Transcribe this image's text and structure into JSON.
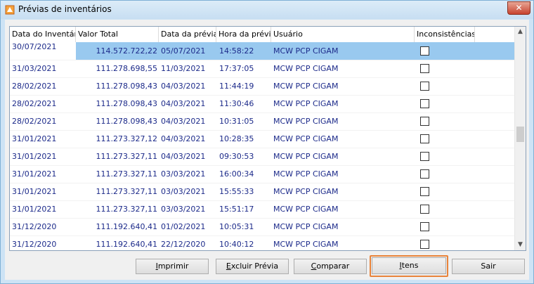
{
  "window": {
    "title": "Prévias de inventários",
    "close_label": "✕"
  },
  "columns": [
    "Data do Inventário",
    "Valor Total",
    "Data da prévia",
    "Hora da prévia",
    "Usuário",
    "Inconsistências"
  ],
  "rows": [
    {
      "date": "30/07/2021",
      "total": "114.572.722,22",
      "preview_date": "05/07/2021",
      "preview_time": "14:58:22",
      "user": "MCW  PCP CIGAM",
      "inconsistent": false
    },
    {
      "date": "31/03/2021",
      "total": "111.278.698,55",
      "preview_date": "11/03/2021",
      "preview_time": "17:37:05",
      "user": "MCW  PCP CIGAM",
      "inconsistent": false
    },
    {
      "date": "28/02/2021",
      "total": "111.278.098,43",
      "preview_date": "04/03/2021",
      "preview_time": "11:44:19",
      "user": "MCW  PCP CIGAM",
      "inconsistent": false
    },
    {
      "date": "28/02/2021",
      "total": "111.278.098,43",
      "preview_date": "04/03/2021",
      "preview_time": "11:30:46",
      "user": "MCW  PCP CIGAM",
      "inconsistent": false
    },
    {
      "date": "28/02/2021",
      "total": "111.278.098,43",
      "preview_date": "04/03/2021",
      "preview_time": "10:31:05",
      "user": "MCW  PCP CIGAM",
      "inconsistent": false
    },
    {
      "date": "31/01/2021",
      "total": "111.273.327,12",
      "preview_date": "04/03/2021",
      "preview_time": "10:28:35",
      "user": "MCW  PCP CIGAM",
      "inconsistent": false
    },
    {
      "date": "31/01/2021",
      "total": "111.273.327,11",
      "preview_date": "04/03/2021",
      "preview_time": "09:30:53",
      "user": "MCW  PCP CIGAM",
      "inconsistent": false
    },
    {
      "date": "31/01/2021",
      "total": "111.273.327,11",
      "preview_date": "03/03/2021",
      "preview_time": "16:00:34",
      "user": "MCW  PCP CIGAM",
      "inconsistent": false
    },
    {
      "date": "31/01/2021",
      "total": "111.273.327,11",
      "preview_date": "03/03/2021",
      "preview_time": "15:55:33",
      "user": "MCW  PCP CIGAM",
      "inconsistent": false
    },
    {
      "date": "31/01/2021",
      "total": "111.273.327,11",
      "preview_date": "03/03/2021",
      "preview_time": "15:51:17",
      "user": "MCW  PCP CIGAM",
      "inconsistent": false
    },
    {
      "date": "31/12/2020",
      "total": "111.192.640,41",
      "preview_date": "01/02/2021",
      "preview_time": "10:05:31",
      "user": "MCW  PCP CIGAM",
      "inconsistent": false
    },
    {
      "date": "31/12/2020",
      "total": "111.192.640,41",
      "preview_date": "22/12/2020",
      "preview_time": "10:40:12",
      "user": "MCW  PCP CIGAM",
      "inconsistent": false
    }
  ],
  "selected_row": 0,
  "buttons": [
    {
      "key": "imprimir",
      "accel": "I",
      "rest": "mprimir"
    },
    {
      "key": "excluir",
      "accel": "E",
      "rest": "xcluir Prévia"
    },
    {
      "key": "comparar",
      "accel": "C",
      "rest": "omparar"
    },
    {
      "key": "itens",
      "accel": "I",
      "rest": "tens"
    },
    {
      "key": "sair",
      "accel": "",
      "rest": "Sair"
    }
  ],
  "colors": {
    "text": "#1c2a8a",
    "selection": "#99c9ef",
    "focus": "#e8833a"
  }
}
